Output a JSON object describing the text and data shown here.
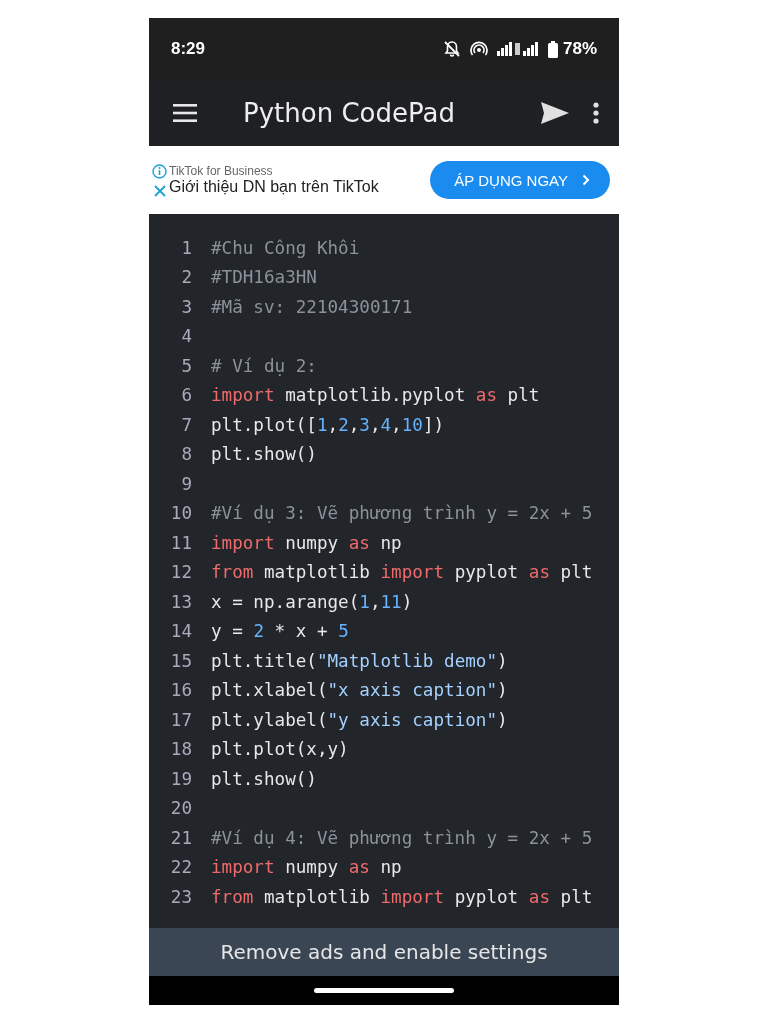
{
  "status_bar": {
    "time": "8:29",
    "battery": "78%"
  },
  "app_bar": {
    "title": "Python CodePad"
  },
  "ad": {
    "advertiser": "TikTok for Business",
    "headline": "Giới thiệu DN bạn trên TikTok",
    "cta": "ÁP DỤNG NGAY"
  },
  "code_lines": [
    {
      "number": "1",
      "tokens": [
        {
          "kind": "comment",
          "text": "#Chu Công Khôi"
        }
      ]
    },
    {
      "number": "2",
      "tokens": [
        {
          "kind": "comment",
          "text": "#TDH16a3HN"
        }
      ]
    },
    {
      "number": "3",
      "tokens": [
        {
          "kind": "comment",
          "text": "#Mã sv: 22104300171"
        }
      ]
    },
    {
      "number": "4"
    },
    {
      "number": "5",
      "tokens": [
        {
          "kind": "comment",
          "text": "# Ví dụ 2:"
        }
      ]
    },
    {
      "number": "6",
      "tokens": [
        {
          "kind": "keyword",
          "text": "import"
        },
        {
          "kind": "plain",
          "text": " matplotlib.pyplot "
        },
        {
          "kind": "keyword",
          "text": "as"
        },
        {
          "kind": "plain",
          "text": " plt"
        }
      ]
    },
    {
      "number": "7",
      "tokens": [
        {
          "kind": "plain",
          "text": "plt.plot(["
        },
        {
          "kind": "number",
          "text": "1"
        },
        {
          "kind": "plain",
          "text": ","
        },
        {
          "kind": "number",
          "text": "2"
        },
        {
          "kind": "plain",
          "text": ","
        },
        {
          "kind": "number",
          "text": "3"
        },
        {
          "kind": "plain",
          "text": ","
        },
        {
          "kind": "number",
          "text": "4"
        },
        {
          "kind": "plain",
          "text": ","
        },
        {
          "kind": "number",
          "text": "10"
        },
        {
          "kind": "plain",
          "text": "])"
        }
      ]
    },
    {
      "number": "8",
      "tokens": [
        {
          "kind": "plain",
          "text": "plt.show()"
        }
      ]
    },
    {
      "number": "9"
    },
    {
      "number": "10",
      "tokens": [
        {
          "kind": "comment",
          "text": "#Ví dụ 3: Vẽ phương trình y = 2x + 5"
        }
      ]
    },
    {
      "number": "11",
      "tokens": [
        {
          "kind": "keyword",
          "text": "import"
        },
        {
          "kind": "plain",
          "text": " numpy "
        },
        {
          "kind": "keyword",
          "text": "as"
        },
        {
          "kind": "plain",
          "text": " np"
        }
      ]
    },
    {
      "number": "12",
      "tokens": [
        {
          "kind": "keyword",
          "text": "from"
        },
        {
          "kind": "plain",
          "text": " matplotlib "
        },
        {
          "kind": "keyword",
          "text": "import"
        },
        {
          "kind": "plain",
          "text": " pyplot "
        },
        {
          "kind": "keyword",
          "text": "as"
        },
        {
          "kind": "plain",
          "text": " plt"
        }
      ]
    },
    {
      "number": "13",
      "tokens": [
        {
          "kind": "plain",
          "text": "x = np.arange("
        },
        {
          "kind": "number",
          "text": "1"
        },
        {
          "kind": "plain",
          "text": ","
        },
        {
          "kind": "number",
          "text": "11"
        },
        {
          "kind": "plain",
          "text": ")"
        }
      ]
    },
    {
      "number": "14",
      "tokens": [
        {
          "kind": "plain",
          "text": "y = "
        },
        {
          "kind": "number",
          "text": "2"
        },
        {
          "kind": "plain",
          "text": " * x + "
        },
        {
          "kind": "number",
          "text": "5"
        }
      ]
    },
    {
      "number": "15",
      "tokens": [
        {
          "kind": "plain",
          "text": "plt.title("
        },
        {
          "kind": "string",
          "text": "\"Matplotlib demo\""
        },
        {
          "kind": "plain",
          "text": ")"
        }
      ]
    },
    {
      "number": "16",
      "tokens": [
        {
          "kind": "plain",
          "text": "plt.xlabel("
        },
        {
          "kind": "string",
          "text": "\"x axis caption\""
        },
        {
          "kind": "plain",
          "text": ")"
        }
      ]
    },
    {
      "number": "17",
      "tokens": [
        {
          "kind": "plain",
          "text": "plt.ylabel("
        },
        {
          "kind": "string",
          "text": "\"y axis caption\""
        },
        {
          "kind": "plain",
          "text": ")"
        }
      ]
    },
    {
      "number": "18",
      "tokens": [
        {
          "kind": "plain",
          "text": "plt.plot(x,y)"
        }
      ]
    },
    {
      "number": "19",
      "tokens": [
        {
          "kind": "plain",
          "text": "plt.show()"
        }
      ]
    },
    {
      "number": "20"
    },
    {
      "number": "21",
      "tokens": [
        {
          "kind": "comment",
          "text": "#Ví dụ 4: Vẽ phương trình y = 2x + 5"
        }
      ]
    },
    {
      "number": "22",
      "tokens": [
        {
          "kind": "keyword",
          "text": "import"
        },
        {
          "kind": "plain",
          "text": " numpy "
        },
        {
          "kind": "keyword",
          "text": "as"
        },
        {
          "kind": "plain",
          "text": " np"
        }
      ]
    },
    {
      "number": "23",
      "tokens": [
        {
          "kind": "keyword",
          "text": "from"
        },
        {
          "kind": "plain",
          "text": " matplotlib "
        },
        {
          "kind": "keyword",
          "text": "import"
        },
        {
          "kind": "plain",
          "text": " pyplot "
        },
        {
          "kind": "keyword",
          "text": "as"
        },
        {
          "kind": "plain",
          "text": " plt"
        }
      ]
    }
  ],
  "bottom_banner": {
    "text": "Remove ads and enable settings"
  }
}
